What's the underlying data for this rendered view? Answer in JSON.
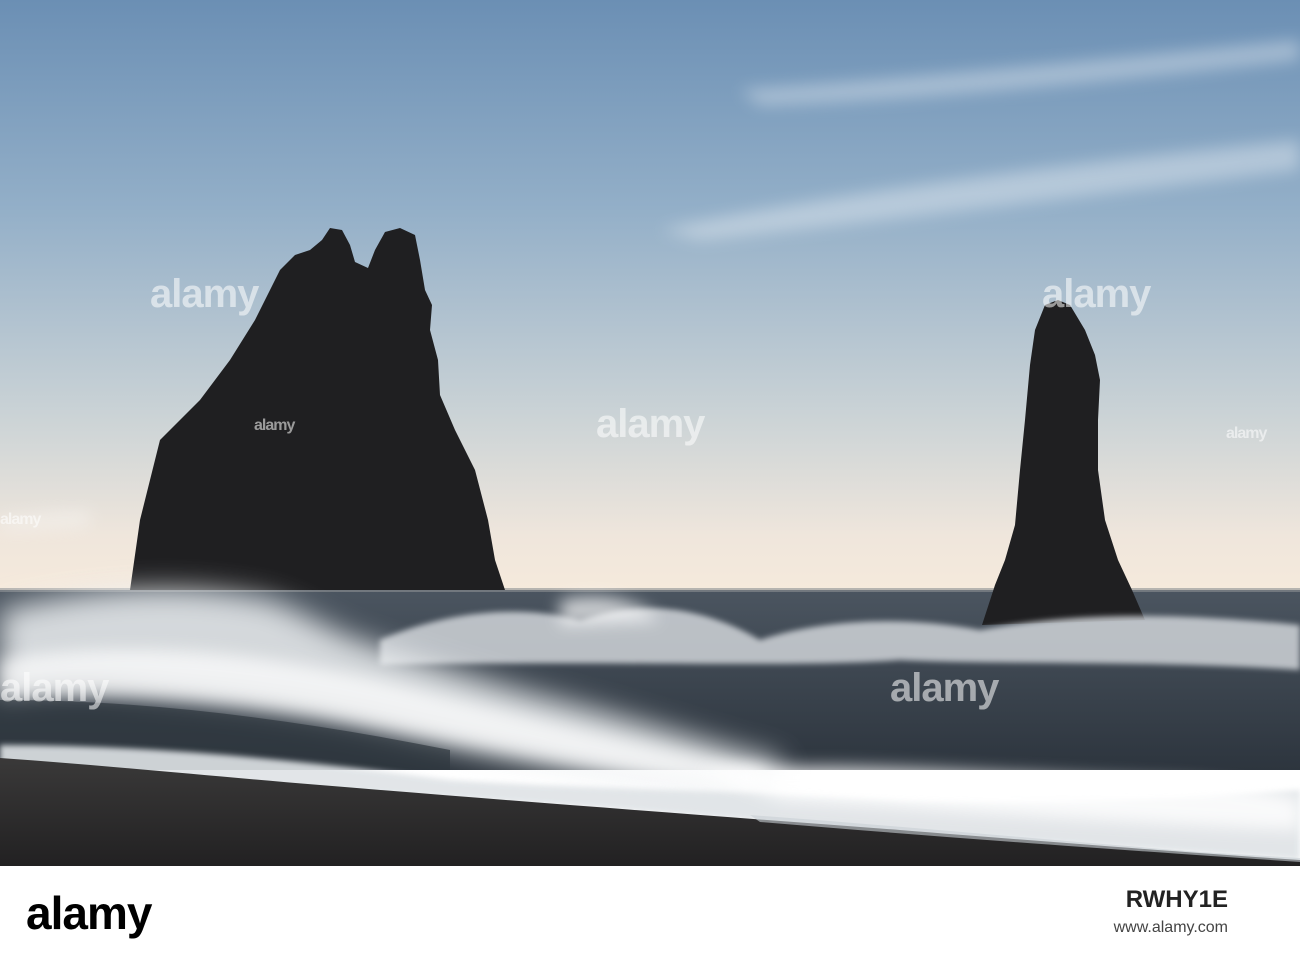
{
  "watermark": {
    "text": "alamy"
  },
  "footer": {
    "logo": "alamy",
    "image_id": "RWHY1E",
    "site": "www.alamy.com"
  },
  "scene": {
    "sky_top_color": "#6e90b3",
    "sky_horizon_color": "#f3e8dc",
    "sea_color": "#3f4a55",
    "rock_color": "#1e1e20",
    "sand_color": "#2c2b2b",
    "spray_color": "#ffffff"
  }
}
